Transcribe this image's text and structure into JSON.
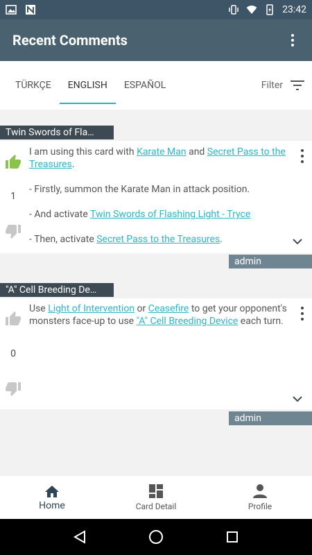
{
  "status": {
    "time": "23:42"
  },
  "app": {
    "title": "Recent Comments"
  },
  "tabs": [
    {
      "label": "TÜRKÇE",
      "active": false
    },
    {
      "label": "ENGLISH",
      "active": true
    },
    {
      "label": "ESPAÑOL",
      "active": false
    }
  ],
  "filter": {
    "label": "Filter"
  },
  "comments": [
    {
      "card": "Twin Swords of Fla…",
      "score": "1",
      "author": "admin",
      "text": {
        "p1_a": "I am using this card with ",
        "p1_link1": "Karate Man",
        "p1_b": " and ",
        "p1_link2": "Secret Pass to the Treasures",
        "p1_c": ".",
        "p2": "- Firstly,  summon the Karate Man in attack position.",
        "p3_a": "- And activate ",
        "p3_link": "Twin Swords of Flashing Light - Tryce",
        "p4_a": "- Then, activate ",
        "p4_link": "Secret Pass to the Treasures",
        "p4_c": "."
      }
    },
    {
      "card": "\"A\" Cell Breeding De…",
      "score": "0",
      "author": "admin",
      "text": {
        "a": "Use ",
        "link1": "Light of Intervention",
        "b": "  or ",
        "link2": "Ceasefire",
        "c": " to get your opponent's monsters face-up to use ",
        "link3": "\"A\" Cell Breeding Device",
        "d": " each turn."
      }
    }
  ],
  "bottom_nav": [
    {
      "label": "Home",
      "icon": "home-icon",
      "active": true
    },
    {
      "label": "Card Detail",
      "icon": "grid-icon",
      "active": false
    },
    {
      "label": "Profile",
      "icon": "person-icon",
      "active": false
    }
  ],
  "colors": {
    "accent": "#25b0c6",
    "app_bar": "#4a6270",
    "liked": "#8bc34a"
  }
}
